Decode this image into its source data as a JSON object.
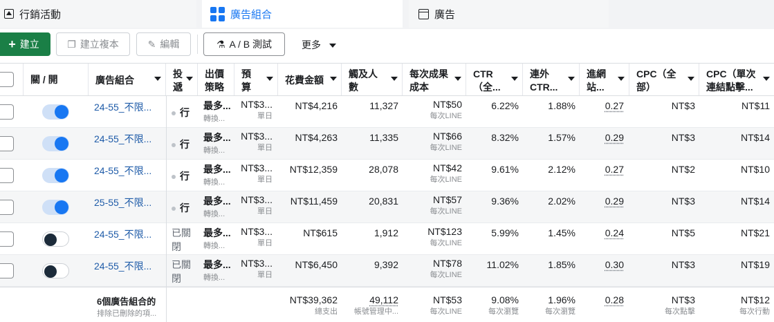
{
  "tabs": [
    {
      "label": "行銷活動",
      "icon": "flag-icon"
    },
    {
      "label": "廣告組合",
      "icon": "grid-icon",
      "active": true
    },
    {
      "label": "廣告",
      "icon": "ad-icon"
    }
  ],
  "toolbar": {
    "create": "建立",
    "duplicate": "建立複本",
    "edit": "編輯",
    "ab_test": "A / B 測試",
    "more": "更多"
  },
  "columns": {
    "toggle": "關 / 開",
    "name": "廣告組合",
    "delivery": [
      "投",
      "遞"
    ],
    "bid": [
      "出價",
      "策略"
    ],
    "budget": [
      "預",
      "算"
    ],
    "spend": "花費金額",
    "reach": [
      "觸及人",
      "數"
    ],
    "cpr": [
      "每次成果",
      "成本"
    ],
    "ctr": [
      "CTR",
      "（全..."
    ],
    "outbound": [
      "連外",
      "CTR..."
    ],
    "landing": [
      "進網",
      "站..."
    ],
    "cpc_all": [
      "CPC（全",
      "部）"
    ],
    "cpc_link": [
      "CPC（單次",
      "連結點擊..."
    ]
  },
  "rows": [
    {
      "on": true,
      "name": "24-55_不限...",
      "delivery": "行",
      "bid": "最多...",
      "bid_sub": "轉換...",
      "budget": "NT$3...",
      "budget_sub": "單日",
      "spend": "NT$4,216",
      "reach": "11,327",
      "cpr": "NT$50",
      "cpr_sub": "每次LINE",
      "ctr": "6.22%",
      "outbound": "1.88%",
      "landing": "0.27",
      "cpc_all": "NT$3",
      "cpc_link": "NT$11"
    },
    {
      "on": true,
      "name": "24-55_不限...",
      "delivery": "行",
      "bid": "最多...",
      "bid_sub": "轉換...",
      "budget": "NT$3...",
      "budget_sub": "單日",
      "spend": "NT$4,263",
      "reach": "11,335",
      "cpr": "NT$66",
      "cpr_sub": "每次LINE",
      "ctr": "8.32%",
      "outbound": "1.57%",
      "landing": "0.29",
      "cpc_all": "NT$3",
      "cpc_link": "NT$14"
    },
    {
      "on": true,
      "name": "24-55_不限...",
      "delivery": "行",
      "bid": "最多...",
      "bid_sub": "轉換...",
      "budget": "NT$3...",
      "budget_sub": "單日",
      "spend": "NT$12,359",
      "reach": "28,078",
      "cpr": "NT$42",
      "cpr_sub": "每次LINE",
      "ctr": "9.61%",
      "outbound": "2.12%",
      "landing": "0.27",
      "cpc_all": "NT$2",
      "cpc_link": "NT$10"
    },
    {
      "on": true,
      "name": "25-55_不限...",
      "delivery": "行",
      "bid": "最多...",
      "bid_sub": "轉換...",
      "budget": "NT$3...",
      "budget_sub": "單日",
      "spend": "NT$11,459",
      "reach": "20,831",
      "cpr": "NT$57",
      "cpr_sub": "每次LINE",
      "ctr": "9.36%",
      "outbound": "2.02%",
      "landing": "0.29",
      "cpc_all": "NT$3",
      "cpc_link": "NT$14"
    },
    {
      "on": false,
      "name": "24-55_不限...",
      "delivery": "已關",
      "delivery2": "閉",
      "bid": "最多...",
      "bid_sub": "轉換...",
      "budget": "NT$3...",
      "budget_sub": "單日",
      "spend": "NT$615",
      "reach": "1,912",
      "cpr": "NT$123",
      "cpr_sub": "每次LINE",
      "ctr": "5.99%",
      "outbound": "1.45%",
      "landing": "0.24",
      "cpc_all": "NT$5",
      "cpc_link": "NT$21"
    },
    {
      "on": false,
      "name": "24-55_不限...",
      "delivery": "已關",
      "delivery2": "閉",
      "bid": "最多...",
      "bid_sub": "轉換...",
      "budget": "NT$3...",
      "budget_sub": "單日",
      "spend": "NT$6,450",
      "reach": "9,392",
      "cpr": "NT$78",
      "cpr_sub": "每次LINE",
      "ctr": "11.02%",
      "outbound": "1.85%",
      "landing": "0.30",
      "cpc_all": "NT$3",
      "cpc_link": "NT$19"
    }
  ],
  "summary": {
    "title": "6個廣告組合的",
    "title_sub": "排除已刪除的項...",
    "spend": "NT$39,362",
    "spend_sub": "總支出",
    "reach": "49,112",
    "reach_sub": "帳號管理中...",
    "cpr": "NT$53",
    "cpr_sub": "每次LINE",
    "ctr": "9.08%",
    "ctr_sub": "每次瀏覽",
    "outbound": "1.96%",
    "outbound_sub": "每次瀏覽",
    "landing": "0.28",
    "cpc_all": "NT$3",
    "cpc_all_sub": "每次點擊",
    "cpc_link": "NT$12",
    "cpc_link_sub": "每次行動"
  }
}
